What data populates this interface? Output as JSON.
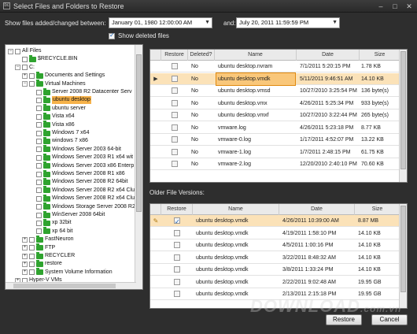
{
  "window": {
    "title": "Select Files and Folders to Restore",
    "icon": "app-icon",
    "icon_text": "bc"
  },
  "filter": {
    "label": "Show files added/changed between:",
    "start_date": "January 01, 1980 12:00:00 AM",
    "and_label": "and:",
    "end_date": "July 20, 2011 11:59:59 PM",
    "show_deleted_label": "Show deleted files",
    "show_deleted_checked": true
  },
  "tree": [
    {
      "label": "All Files",
      "level": 0,
      "exp": "−",
      "folder": false
    },
    {
      "label": "$RECYCLE.BIN",
      "level": 1,
      "exp": "",
      "folder": true
    },
    {
      "label": "C:",
      "level": 1,
      "exp": "−",
      "folder": false
    },
    {
      "label": "Documents and Settings",
      "level": 2,
      "exp": "+",
      "folder": true
    },
    {
      "label": "Virtual Machines",
      "level": 2,
      "exp": "−",
      "folder": true
    },
    {
      "label": "Server 2008 R2 Datacenter Serv",
      "level": 3,
      "exp": "",
      "folder": true
    },
    {
      "label": "ubuntu desktop",
      "level": 3,
      "exp": "",
      "folder": true,
      "selected": true
    },
    {
      "label": "ubuntu server",
      "level": 3,
      "exp": "",
      "folder": true
    },
    {
      "label": "Vista x64",
      "level": 3,
      "exp": "",
      "folder": true
    },
    {
      "label": "Vista x86",
      "level": 3,
      "exp": "",
      "folder": true
    },
    {
      "label": "Windows 7 x64",
      "level": 3,
      "exp": "",
      "folder": true
    },
    {
      "label": "windows 7 x86",
      "level": 3,
      "exp": "",
      "folder": true
    },
    {
      "label": "Windows Server 2003 64-bit",
      "level": 3,
      "exp": "",
      "folder": true
    },
    {
      "label": "Windows Server 2003 R1 x64 wit",
      "level": 3,
      "exp": "",
      "folder": true
    },
    {
      "label": "Windows Server 2003 x86 Enterp",
      "level": 3,
      "exp": "",
      "folder": true
    },
    {
      "label": "Windows Server 2008 R1 x86",
      "level": 3,
      "exp": "",
      "folder": true
    },
    {
      "label": "Windows Server 2008 R2 64bit",
      "level": 3,
      "exp": "",
      "folder": true
    },
    {
      "label": "Windows Server 2008 R2 x64 Clu",
      "level": 3,
      "exp": "",
      "folder": true
    },
    {
      "label": "Windows Server 2008 R2 x64 Clu",
      "level": 3,
      "exp": "",
      "folder": true
    },
    {
      "label": "Windows Storage Server 2008 R2",
      "level": 3,
      "exp": "",
      "folder": true
    },
    {
      "label": "WinServer 2008 64bit",
      "level": 3,
      "exp": "",
      "folder": true
    },
    {
      "label": "xp 32bit",
      "level": 3,
      "exp": "",
      "folder": true
    },
    {
      "label": "xp 64 bit",
      "level": 3,
      "exp": "",
      "folder": true
    },
    {
      "label": "FastNeuron",
      "level": 2,
      "exp": "+",
      "folder": true
    },
    {
      "label": "FTP",
      "level": 2,
      "exp": "+",
      "folder": true
    },
    {
      "label": "RECYCLER",
      "level": 2,
      "exp": "+",
      "folder": true
    },
    {
      "label": "restore",
      "level": 2,
      "exp": "+",
      "folder": true
    },
    {
      "label": "System Volume Information",
      "level": 2,
      "exp": "+",
      "folder": true
    },
    {
      "label": "Hyper-V VMs",
      "level": 1,
      "exp": "+",
      "folder": false
    }
  ],
  "files_table": {
    "headers": {
      "restore": "Restore",
      "deleted": "Deleted?",
      "name": "Name",
      "date": "Date",
      "size": "Size"
    },
    "rows": [
      {
        "deleted": "No",
        "name": "ubuntu desktop.nvram",
        "date": "7/1/2011 5:20:15 PM",
        "size": "1.78 KB"
      },
      {
        "deleted": "No",
        "name": "ubuntu desktop.vmdk",
        "date": "5/11/2011 9:46:51 AM",
        "size": "14.10 KB",
        "active": true
      },
      {
        "deleted": "No",
        "name": "ubuntu desktop.vmsd",
        "date": "10/27/2010 3:25:54 PM",
        "size": "136 byte(s)"
      },
      {
        "deleted": "No",
        "name": "ubuntu desktop.vmx",
        "date": "4/26/2011 5:25:34 PM",
        "size": "933 byte(s)"
      },
      {
        "deleted": "No",
        "name": "ubuntu desktop.vmxf",
        "date": "10/27/2010 3:22:44 PM",
        "size": "265 byte(s)"
      },
      {
        "deleted": "No",
        "name": "vmware.log",
        "date": "4/26/2011 5:23:18 PM",
        "size": "8.77 KB"
      },
      {
        "deleted": "No",
        "name": "vmware-0.log",
        "date": "1/17/2011 4:52:07 PM",
        "size": "13.22 KB"
      },
      {
        "deleted": "No",
        "name": "vmware-1.log",
        "date": "1/7/2011 2:48:15 PM",
        "size": "61.75 KB"
      },
      {
        "deleted": "No",
        "name": "vmware-2.log",
        "date": "12/20/2010 2:40:10 PM",
        "size": "70.60 KB"
      }
    ]
  },
  "older_versions": {
    "label": "Older File Versions:",
    "headers": {
      "restore": "Restore",
      "name": "Name",
      "date": "Date",
      "size": "Size"
    },
    "rows": [
      {
        "checked": true,
        "name": "ubuntu desktop.vmdk",
        "date": "4/26/2011 10:39:00 AM",
        "size": "8.87 MB",
        "active": true
      },
      {
        "checked": false,
        "name": "ubuntu desktop.vmdk",
        "date": "4/19/2011 1:58:10 PM",
        "size": "14.10 KB"
      },
      {
        "checked": false,
        "name": "ubuntu desktop.vmdk",
        "date": "4/5/2011 1:00:16 PM",
        "size": "14.10 KB"
      },
      {
        "checked": false,
        "name": "ubuntu desktop.vmdk",
        "date": "3/22/2011 8:48:32 AM",
        "size": "14.10 KB"
      },
      {
        "checked": false,
        "name": "ubuntu desktop.vmdk",
        "date": "3/8/2011 1:33:24 PM",
        "size": "14.10 KB"
      },
      {
        "checked": false,
        "name": "ubuntu desktop.vmdk",
        "date": "2/22/2011 9:02:48 AM",
        "size": "19.95 GB"
      },
      {
        "checked": false,
        "name": "ubuntu desktop.vmdk",
        "date": "2/13/2011 2:15:18 PM",
        "size": "19.95 GB"
      }
    ]
  },
  "buttons": {
    "restore": "Restore",
    "cancel": "Cancel"
  },
  "watermark": {
    "main": "DOWNLOAD",
    "suffix": ".com.vn"
  },
  "colors": {
    "selection": "#f6b24a",
    "folder": "#2fa32f",
    "background": "#2e2e2e"
  }
}
